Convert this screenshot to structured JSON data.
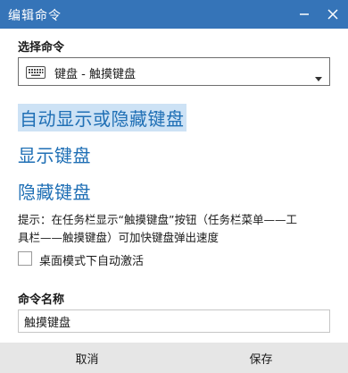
{
  "window": {
    "title": "编辑命令"
  },
  "command_section": {
    "label": "选择命令",
    "selected": "键盘 - 触摸键盘",
    "icon": "keyboard-icon"
  },
  "options": [
    "自动显示或隐藏键盘",
    "显示键盘",
    "隐藏键盘"
  ],
  "tip": {
    "line1": "提示：在任务栏显示“触摸键盘”按钮（任务栏菜单——工",
    "line2": "具栏——触摸键盘）可加快键盘弹出速度"
  },
  "checkbox": {
    "label": "桌面模式下自动激活",
    "checked": false
  },
  "name_section": {
    "label": "命令名称",
    "value": "触摸键盘"
  },
  "footer": {
    "cancel": "取消",
    "save": "保存"
  },
  "colors": {
    "titlebar": "#3574b8",
    "option_text": "#1f6fb5",
    "option_selected_bg": "#cde2f5",
    "footer_bg": "#e6e6e6"
  }
}
